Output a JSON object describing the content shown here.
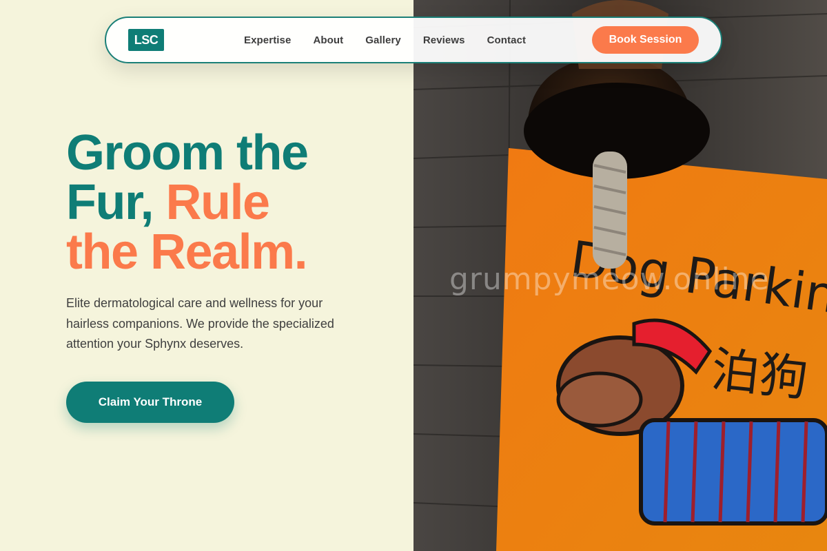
{
  "brand": {
    "logo_text": "LSC"
  },
  "nav": {
    "links": [
      "Expertise",
      "About",
      "Gallery",
      "Reviews",
      "Contact"
    ],
    "book_label": "Book Session"
  },
  "hero": {
    "headline_teal_1": "Groom the",
    "headline_teal_2": "Fur,",
    "headline_coral_1": "Rule",
    "headline_coral_2": "the Realm.",
    "subtext": "Elite dermatological care and wellness for your hairless companions. We provide the specialized attention your Sphynx deserves.",
    "cta_label": "Claim Your Throne"
  },
  "image": {
    "sign_text": "Dog Parkin",
    "sign_text_cn": "泊狗",
    "watermark": "grumpymeow.online"
  },
  "colors": {
    "teal": "#0f7d76",
    "coral": "#fb7a4b",
    "cream": "#f5f4dc"
  }
}
